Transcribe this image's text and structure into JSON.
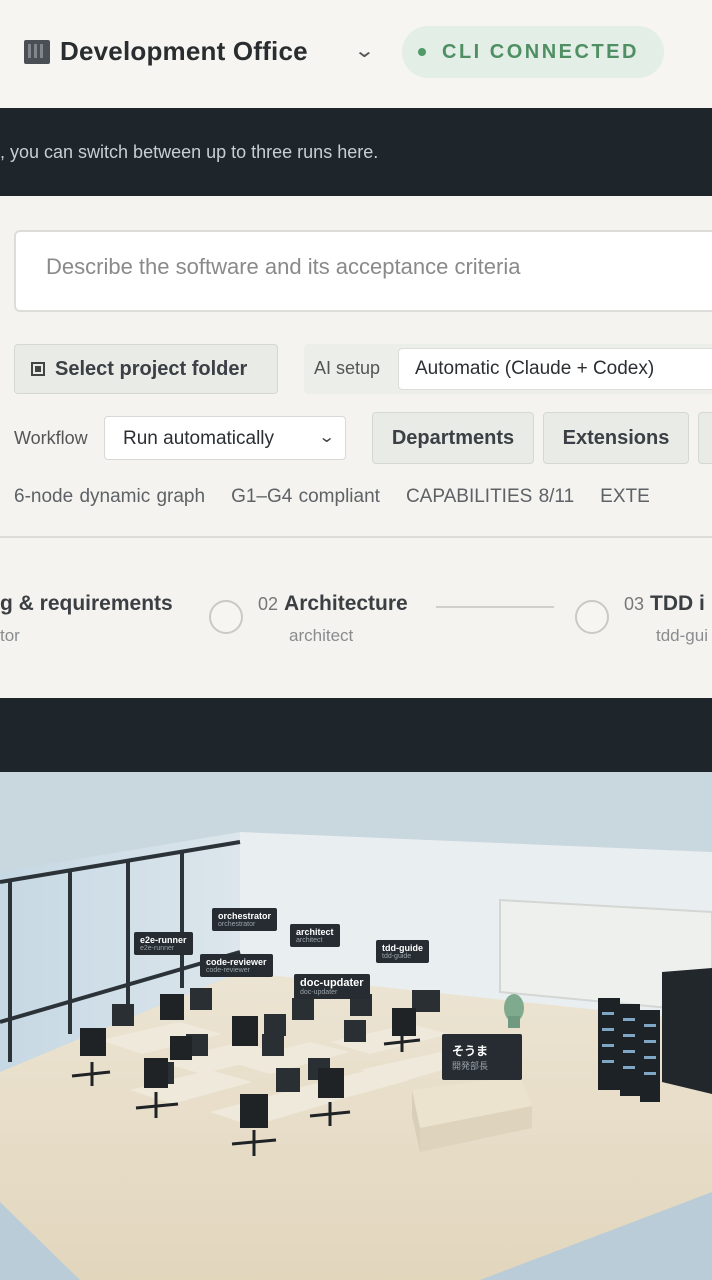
{
  "header": {
    "title": "Development Office",
    "status": "CLI CONNECTED",
    "status_color": "#4f9a68"
  },
  "banner": {
    "text": ", you can switch between up to three runs here."
  },
  "form": {
    "description_placeholder": "Describe the software and its acceptance criteria",
    "folder_button": "Select project folder",
    "ai_setup_label": "AI setup",
    "ai_setup_value": "Automatic (Claude + Codex)",
    "workflow_label": "Workflow",
    "workflow_value": "Run automatically",
    "departments_button": "Departments",
    "extensions_button": "Extensions"
  },
  "stats": [
    "6-node dynamic graph",
    "G1–G4 compliant",
    "CAPABILITIES 8/11",
    "EXTE"
  ],
  "pipeline": {
    "steps": [
      {
        "num": "",
        "title": "g & requirements",
        "agent": "tor"
      },
      {
        "num": "02",
        "title": "Architecture",
        "agent": "architect"
      },
      {
        "num": "03",
        "title": "TDD i",
        "agent": "tdd-gui"
      }
    ]
  },
  "office": {
    "agents": [
      {
        "name": "e2e-runner",
        "role": "e2e-runner"
      },
      {
        "name": "orchestrator",
        "role": "orchestrator"
      },
      {
        "name": "architect",
        "role": "architect"
      },
      {
        "name": "code-reviewer",
        "role": "code-reviewer"
      },
      {
        "name": "tdd-guide",
        "role": "tdd-guide"
      },
      {
        "name": "doc-updater",
        "role": "doc-updater"
      },
      {
        "name": "そうま",
        "role": "開発部長"
      }
    ]
  }
}
